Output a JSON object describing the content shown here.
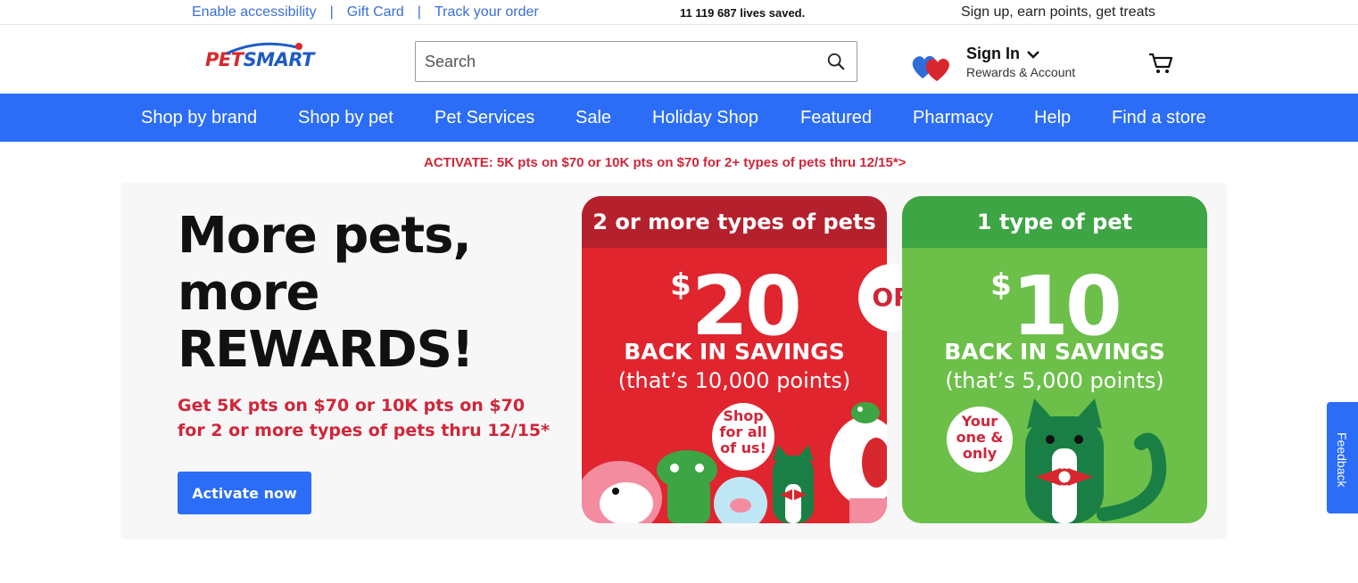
{
  "utility": {
    "links": [
      "Enable accessibility",
      "Gift Card",
      "Track your order"
    ],
    "separator": "|",
    "lives_saved": "11 119 687 lives saved.",
    "signup_promo": "Sign up, earn points, get treats"
  },
  "header": {
    "logo": "PETSMART",
    "search_placeholder": "Search",
    "signin_title": "Sign In",
    "signin_sub": "Rewards & Account"
  },
  "nav": {
    "items": [
      "Shop by brand",
      "Shop by pet",
      "Pet Services",
      "Sale",
      "Holiday Shop",
      "Featured",
      "Pharmacy",
      "Help",
      "Find a store"
    ]
  },
  "promo_line": "ACTIVATE: 5K pts on $70 or 10K pts on $70 for 2+ types of pets thru 12/15*>",
  "hero": {
    "headline_1": "More pets,",
    "headline_2": "more",
    "headline_3": "REWARDS!",
    "subtext": "Get 5K pts on $70 or 10K pts on $70 for 2 or more types of pets thru 12/15*",
    "cta": "Activate now"
  },
  "offers": {
    "multi": {
      "heading": "2 or more types of pets",
      "dollar": "$",
      "amount": "20",
      "savings": "BACK IN SAVINGS",
      "points": "(that’s 10,000 points)",
      "bubble_1": "Shop",
      "bubble_2": "for all",
      "bubble_3": "of us!"
    },
    "or": "OR",
    "single": {
      "heading": "1 type of pet",
      "dollar": "$",
      "amount": "10",
      "savings": "BACK IN SAVINGS",
      "points": "(that’s 5,000 points)",
      "bubble_1": "Your",
      "bubble_2": "one &",
      "bubble_3": "only"
    }
  },
  "feedback": "Feedback",
  "colors": {
    "brand_blue": "#2b6df6",
    "brand_red": "#d0263a",
    "card_red": "#e0252e",
    "card_green": "#6cc04a"
  },
  "icons": [
    "search-icon",
    "hearts-icon",
    "chevron-down-icon",
    "cart-icon"
  ]
}
